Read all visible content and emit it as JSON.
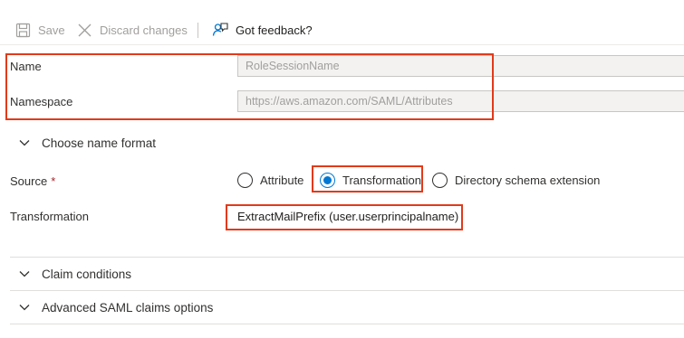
{
  "toolbar": {
    "save_label": "Save",
    "discard_label": "Discard changes",
    "feedback_label": "Got feedback?"
  },
  "form": {
    "name": {
      "label": "Name",
      "value": "RoleSessionName"
    },
    "namespace": {
      "label": "Namespace",
      "value": "https://aws.amazon.com/SAML/Attributes"
    },
    "name_format": {
      "label": "Choose name format"
    },
    "source": {
      "label": "Source",
      "required_mark": "*",
      "options": [
        "Attribute",
        "Transformation",
        "Directory schema extension"
      ],
      "selected": "Transformation"
    },
    "transformation": {
      "label": "Transformation",
      "value": "ExtractMailPrefix (user.userprincipalname)"
    }
  },
  "sections": {
    "claim_conditions": "Claim conditions",
    "advanced": "Advanced SAML claims options"
  },
  "colors": {
    "highlight": "#e23a1a",
    "accent": "#0078d4",
    "disabled_text": "#a19f9d"
  },
  "icons": [
    "save-icon",
    "close-icon",
    "feedback-icon",
    "chevron-down-icon"
  ]
}
